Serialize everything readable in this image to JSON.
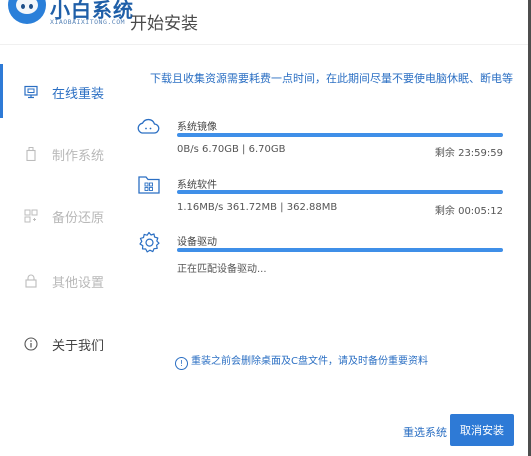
{
  "header": {
    "brand_title": "小白系统",
    "brand_subtitle": "XIAOBAIXITONG.COM",
    "page_title": "开始安装"
  },
  "sidebar": {
    "items": [
      {
        "label": "在线重装",
        "icon": "monitor-icon",
        "active": true
      },
      {
        "label": "制作系统",
        "icon": "usb-icon",
        "active": false
      },
      {
        "label": "备份还原",
        "icon": "backup-icon",
        "active": false
      },
      {
        "label": "其他设置",
        "icon": "lock-icon",
        "active": false
      },
      {
        "label": "关于我们",
        "icon": "info-icon",
        "active": false
      }
    ]
  },
  "main": {
    "notice": "下载且收集资源需要耗费一点时间，在此期间尽量不要使电脑休眠、断电等",
    "tasks": [
      {
        "name": "系统镜像",
        "status": "0B/s 6.70GB | 6.70GB",
        "remaining": "剩余 23:59:59",
        "progress": 1.0,
        "icon": "cloud-icon"
      },
      {
        "name": "系统软件",
        "status": "1.16MB/s 361.72MB | 362.88MB",
        "remaining": "剩余 00:05:12",
        "progress": 1.0,
        "icon": "software-folder-icon"
      },
      {
        "name": "设备驱动",
        "status": "正在匹配设备驱动...",
        "remaining": "",
        "progress": 1.0,
        "icon": "gear-icon"
      }
    ],
    "warning": "重装之前会删除桌面及C盘文件，请及时备份重要资料",
    "warning_icon": "!"
  },
  "footer": {
    "reselect_label": "重选系统",
    "cancel_label": "取消安装"
  },
  "colors": {
    "accent": "#2e7ad6",
    "progress": "#3f8fe8",
    "track": "#dbe8f7",
    "active_text": "#2b6fc3",
    "inactive_text": "#b8b8b8"
  }
}
